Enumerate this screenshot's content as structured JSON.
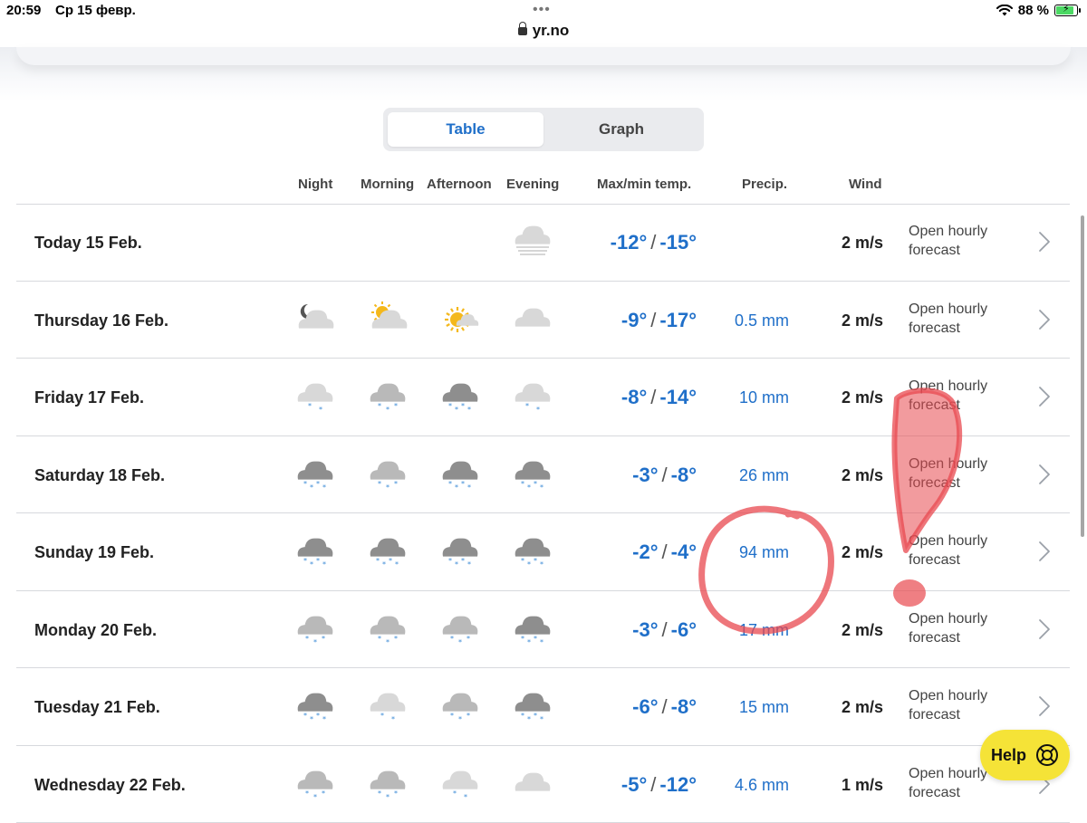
{
  "status": {
    "time": "20:59",
    "date": "Ср 15 февр.",
    "battery": "88 %"
  },
  "browser": {
    "url": "yr.no"
  },
  "view_toggle": {
    "table_label": "Table",
    "graph_label": "Graph",
    "selected": "Table"
  },
  "columns": {
    "night": "Night",
    "morning": "Morning",
    "afternoon": "Afternoon",
    "evening": "Evening",
    "temp": "Max/min temp.",
    "precip": "Precip.",
    "wind": "Wind"
  },
  "rows": [
    {
      "day": "Today 15 Feb.",
      "icons": [
        "none",
        "none",
        "none",
        "fog"
      ],
      "max": "-12°",
      "min": "-15°",
      "precip": "",
      "wind": "2 m/s",
      "link": "Open hourly forecast"
    },
    {
      "day": "Thursday 16 Feb.",
      "icons": [
        "night-cloud",
        "partly-cloudy",
        "sun-cloud",
        "cloud"
      ],
      "max": "-9°",
      "min": "-17°",
      "precip": "0.5 mm",
      "wind": "2 m/s",
      "link": "Open hourly forecast"
    },
    {
      "day": "Friday 17 Feb.",
      "icons": [
        "light-snow",
        "snow",
        "heavy-snow",
        "light-snow"
      ],
      "max": "-8°",
      "min": "-14°",
      "precip": "10 mm",
      "wind": "2 m/s",
      "link": "Open hourly forecast"
    },
    {
      "day": "Saturday 18 Feb.",
      "icons": [
        "heavy-snow",
        "snow",
        "heavy-snow",
        "heavy-snow"
      ],
      "max": "-3°",
      "min": "-8°",
      "precip": "26 mm",
      "wind": "2 m/s",
      "link": "Open hourly forecast"
    },
    {
      "day": "Sunday 19 Feb.",
      "icons": [
        "heavy-snow",
        "heavy-snow",
        "heavy-snow",
        "heavy-snow"
      ],
      "max": "-2°",
      "min": "-4°",
      "precip": "94 mm",
      "wind": "2 m/s",
      "link": "Open hourly forecast"
    },
    {
      "day": "Monday 20 Feb.",
      "icons": [
        "snow",
        "snow",
        "snow",
        "heavy-snow"
      ],
      "max": "-3°",
      "min": "-6°",
      "precip": "17 mm",
      "wind": "2 m/s",
      "link": "Open hourly forecast"
    },
    {
      "day": "Tuesday 21 Feb.",
      "icons": [
        "heavy-snow",
        "light-snow",
        "snow",
        "heavy-snow"
      ],
      "max": "-6°",
      "min": "-8°",
      "precip": "15 mm",
      "wind": "2 m/s",
      "link": "Open hourly forecast"
    },
    {
      "day": "Wednesday 22 Feb.",
      "icons": [
        "snow",
        "snow",
        "light-snow",
        "cloud"
      ],
      "max": "-5°",
      "min": "-12°",
      "precip": "4.6 mm",
      "wind": "1 m/s",
      "link": "Open hourly forecast"
    }
  ],
  "help": {
    "label": "Help",
    "icon": "lifebuoy-icon"
  },
  "colors": {
    "accent": "#1f6fc9",
    "help_bg": "#f5e337",
    "annotation": "#e8484f"
  }
}
